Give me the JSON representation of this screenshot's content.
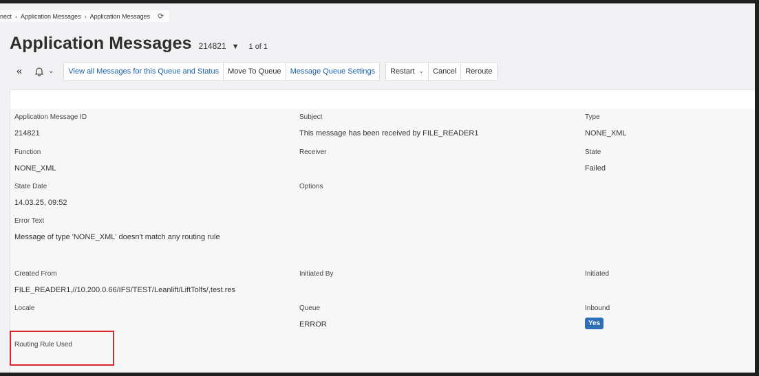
{
  "breadcrumb": {
    "items": [
      "nect",
      "Application Messages",
      "Application Messages"
    ]
  },
  "header": {
    "title": "Application Messages",
    "record_id": "214821",
    "pager": "1 of 1"
  },
  "toolbar": {
    "view_all": "View all Messages for this Queue and Status",
    "move_to_queue": "Move To Queue",
    "queue_settings": "Message Queue Settings",
    "restart": "Restart",
    "cancel": "Cancel",
    "reroute": "Reroute"
  },
  "fields": {
    "message_id": {
      "label": "Application Message ID",
      "value": "214821"
    },
    "subject": {
      "label": "Subject",
      "value": "This message has been received by FILE_READER1"
    },
    "type": {
      "label": "Type",
      "value": "NONE_XML"
    },
    "function": {
      "label": "Function",
      "value": "NONE_XML"
    },
    "receiver": {
      "label": "Receiver",
      "value": ""
    },
    "state": {
      "label": "State",
      "value": "Failed"
    },
    "state_date": {
      "label": "State Date",
      "value": "14.03.25, 09:52"
    },
    "options": {
      "label": "Options",
      "value": ""
    },
    "error_text": {
      "label": "Error Text",
      "value": "Message of type 'NONE_XML' doesn't match any routing rule"
    },
    "created_from": {
      "label": "Created From",
      "value": "FILE_READER1,//10.200.0.66/IFS/TEST/Leanlift/LiftTolfs/,test.res"
    },
    "initiated_by": {
      "label": "Initiated By",
      "value": ""
    },
    "initiated": {
      "label": "Initiated",
      "value": ""
    },
    "locale": {
      "label": "Locale",
      "value": ""
    },
    "queue": {
      "label": "Queue",
      "value": "ERROR"
    },
    "inbound": {
      "label": "Inbound",
      "value": "Yes"
    },
    "routing_rule": {
      "label": "Routing Rule Used",
      "value": ""
    }
  },
  "colors": {
    "link": "#1a5fa8",
    "badge": "#2d6eb6",
    "highlight": "#d9262d"
  },
  "icons": [
    "refresh-icon",
    "collapse-icon",
    "bell-icon",
    "chevron-down-icon",
    "caret-down-icon"
  ]
}
